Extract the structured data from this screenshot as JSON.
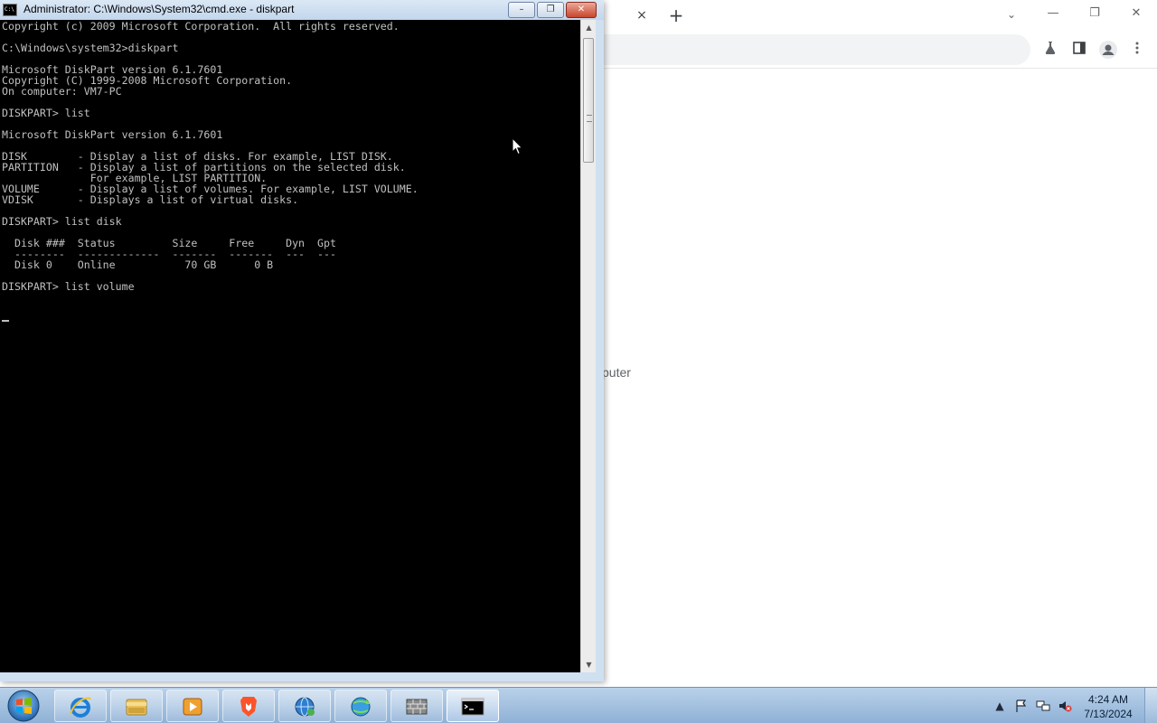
{
  "browser": {
    "tab_close": "×",
    "new_tab": "+",
    "tab_search": "⌄",
    "minimize": "—",
    "restore": "❐",
    "close": "✕",
    "toolbar_icons": [
      "labs-icon",
      "side-panel-icon",
      "profile-icon",
      "menu-icon"
    ],
    "page_text_fragment": "puter"
  },
  "cmd": {
    "title": "Administrator: C:\\Windows\\System32\\cmd.exe - diskpart",
    "icon_text": "C:\\",
    "buttons": {
      "minimize": "–",
      "maximize": "❐",
      "close": "✕"
    },
    "console_lines": [
      "Copyright (c) 2009 Microsoft Corporation.  All rights reserved.",
      "",
      "C:\\Windows\\system32>diskpart",
      "",
      "Microsoft DiskPart version 6.1.7601",
      "Copyright (C) 1999-2008 Microsoft Corporation.",
      "On computer: VM7-PC",
      "",
      "DISKPART> list",
      "",
      "Microsoft DiskPart version 6.1.7601",
      "",
      "DISK        - Display a list of disks. For example, LIST DISK.",
      "PARTITION   - Display a list of partitions on the selected disk.",
      "              For example, LIST PARTITION.",
      "VOLUME      - Display a list of volumes. For example, LIST VOLUME.",
      "VDISK       - Displays a list of virtual disks.",
      "",
      "DISKPART> list disk",
      "",
      "  Disk ###  Status         Size     Free     Dyn  Gpt",
      "  --------  -------------  -------  -------  ---  ---",
      "  Disk 0    Online           70 GB      0 B",
      "",
      "DISKPART> list volume",
      ""
    ]
  },
  "taskbar": {
    "start_label": "Start",
    "apps": [
      {
        "name": "internet-explorer-icon"
      },
      {
        "name": "file-explorer-icon"
      },
      {
        "name": "media-player-icon"
      },
      {
        "name": "brave-browser-icon"
      },
      {
        "name": "network-globe-icon"
      },
      {
        "name": "connectivity-globe-icon"
      },
      {
        "name": "firewall-icon"
      },
      {
        "name": "command-prompt-icon"
      }
    ],
    "tray": {
      "expand": "▲",
      "clock_time": "4:24 AM",
      "clock_date": "7/13/2024"
    }
  },
  "colors": {
    "console_bg": "#000000",
    "console_fg": "#c0c0c0",
    "taskbar": "#a7c3e2",
    "cmd_close": "#c9462c"
  }
}
